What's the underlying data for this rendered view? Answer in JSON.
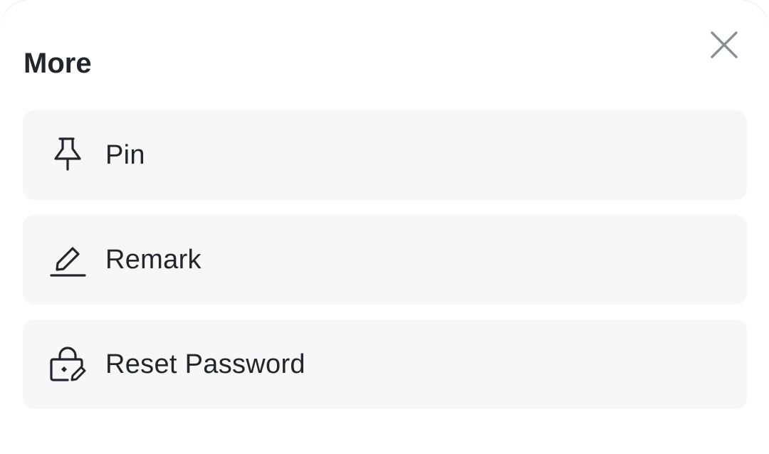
{
  "sheet": {
    "title": "More",
    "close_icon": "close-icon"
  },
  "options": [
    {
      "label": "Pin",
      "icon": "pin-icon"
    },
    {
      "label": "Remark",
      "icon": "pencil-icon"
    },
    {
      "label": "Reset Password",
      "icon": "lock-edit-icon"
    }
  ],
  "colors": {
    "text": "#23252b",
    "row_background": "#f7f7f8",
    "close_icon": "#8a8d94",
    "sheet_background": "#ffffff"
  }
}
